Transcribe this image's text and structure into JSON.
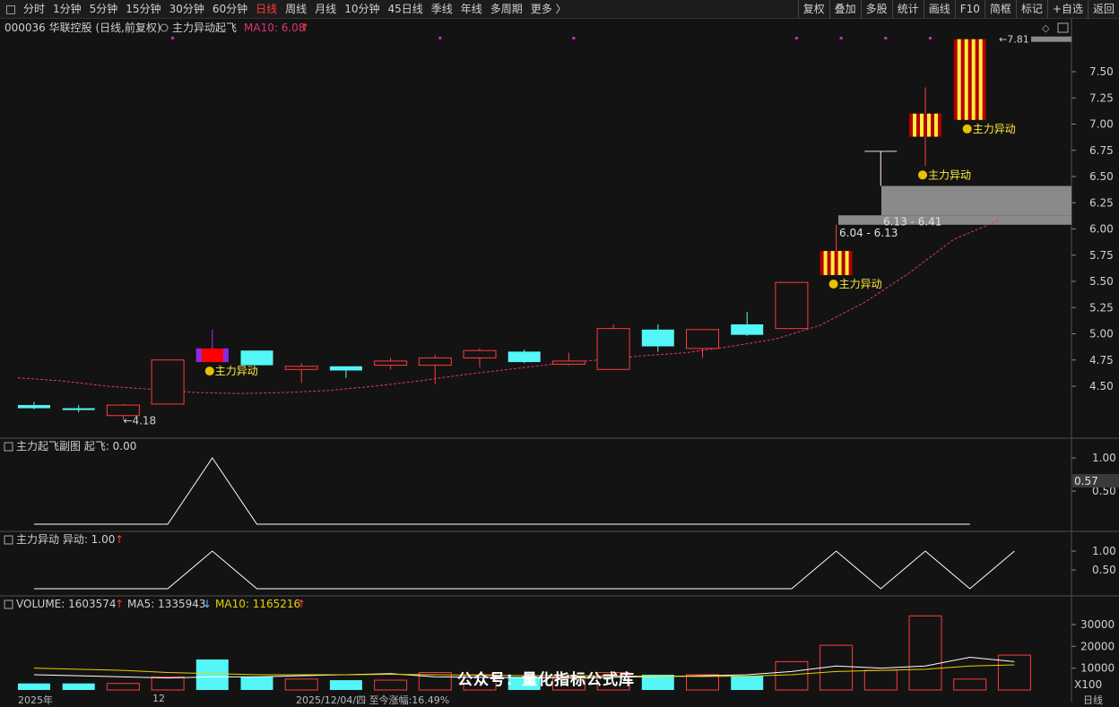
{
  "toolbar": {
    "periods": [
      "分时",
      "1分钟",
      "5分钟",
      "15分钟",
      "30分钟",
      "60分钟",
      "日线",
      "周线",
      "月线",
      "10分钟",
      "45日线",
      "季线",
      "年线",
      "多周期",
      "更多 〉"
    ],
    "active_period": "日线",
    "buttons": [
      "复权",
      "叠加",
      "多股",
      "统计",
      "画线",
      "F10",
      "简框",
      "标记",
      "+自选",
      "返回"
    ]
  },
  "main_header": {
    "stock": "000036 华联控股 (日线,前复权)",
    "indicator": "主力异动起飞",
    "ma10_label": "MA10: 6.08",
    "ma10_arrow": "↑"
  },
  "sub1_header": {
    "name": "主力起飞副图",
    "value_label": "起飞: 0.00"
  },
  "sub2_header": {
    "name": "主力异动",
    "value_label": "异动: 1.00",
    "arrow": "↑"
  },
  "vol_header": {
    "vol_label": "VOLUME: 1603574",
    "vol_arrow": "↑",
    "ma5_label": "MA5: 1335943",
    "ma5_arrow": "↓",
    "ma10_label": "MA10: 1165216",
    "ma10_arrow": "↑"
  },
  "annotations": {
    "signal": "主力异动",
    "low_price": "4.18",
    "high_price": "7.81",
    "zone1": "6.04 - 6.13",
    "zone2": "6.13 - 6.41"
  },
  "axis": {
    "price_ticks": [
      "7.50",
      "7.25",
      "7.00",
      "6.75",
      "6.50",
      "6.25",
      "6.00",
      "5.75",
      "5.50",
      "5.25",
      "5.00",
      "4.75",
      "4.50"
    ],
    "sub_ticks": [
      "1.00",
      "0.50"
    ],
    "sub1_current": "0.57",
    "vol_ticks": [
      "30000",
      "20000",
      "10000"
    ],
    "vol_unit": "X100"
  },
  "footer": {
    "year": "2025年",
    "month": "12",
    "date_info": "2025/12/04/四  至今涨幅:16.49%",
    "right": "日线"
  },
  "watermark": "公众号：量化指标公式库",
  "colors": {
    "up": "#ff3b3b",
    "down": "#54f6f7",
    "ma_main": "#e0307a",
    "signal_text": "#ffeb3b",
    "vol_ma5": "#ffffff",
    "vol_ma10": "#e6d200",
    "zone": "#8a8a8a"
  },
  "chart_data": {
    "type": "candlestick",
    "candles": [
      {
        "o": 4.32,
        "h": 4.35,
        "l": 4.28,
        "c": 4.29
      },
      {
        "o": 4.29,
        "h": 4.32,
        "l": 4.25,
        "c": 4.28
      },
      {
        "o": 4.22,
        "h": 4.33,
        "l": 4.18,
        "c": 4.32
      },
      {
        "o": 4.33,
        "h": 4.75,
        "l": 4.33,
        "c": 4.75
      },
      {
        "o": 4.86,
        "h": 5.04,
        "l": 4.73,
        "c": 4.73,
        "signal": true,
        "special": "mark"
      },
      {
        "o": 4.84,
        "h": 4.84,
        "l": 4.7,
        "c": 4.7
      },
      {
        "o": 4.66,
        "h": 4.72,
        "l": 4.53,
        "c": 4.69
      },
      {
        "o": 4.69,
        "h": 4.69,
        "l": 4.58,
        "c": 4.65
      },
      {
        "o": 4.7,
        "h": 4.77,
        "l": 4.66,
        "c": 4.74
      },
      {
        "o": 4.7,
        "h": 4.8,
        "l": 4.52,
        "c": 4.77
      },
      {
        "o": 4.77,
        "h": 4.86,
        "l": 4.68,
        "c": 4.84
      },
      {
        "o": 4.83,
        "h": 4.85,
        "l": 4.72,
        "c": 4.73
      },
      {
        "o": 4.71,
        "h": 4.82,
        "l": 4.7,
        "c": 4.74
      },
      {
        "o": 4.66,
        "h": 5.09,
        "l": 4.66,
        "c": 5.05
      },
      {
        "o": 5.04,
        "h": 5.09,
        "l": 4.83,
        "c": 4.88
      },
      {
        "o": 4.86,
        "h": 5.04,
        "l": 4.77,
        "c": 5.04
      },
      {
        "o": 5.09,
        "h": 5.21,
        "l": 4.98,
        "c": 4.99
      },
      {
        "o": 5.05,
        "h": 5.49,
        "l": 5.05,
        "c": 5.49
      },
      {
        "o": 5.56,
        "h": 6.04,
        "l": 5.56,
        "c": 5.79,
        "signal": true,
        "special": "striped"
      },
      {
        "o": 6.74,
        "h": 6.74,
        "l": 6.41,
        "c": 6.74,
        "special": "tline"
      },
      {
        "o": 6.88,
        "h": 7.35,
        "l": 6.6,
        "c": 7.1,
        "signal": true,
        "special": "striped"
      },
      {
        "o": 7.04,
        "h": 7.81,
        "l": 7.04,
        "c": 7.81,
        "signal": true,
        "special": "striped"
      }
    ],
    "ma10": [
      4.58,
      4.55,
      4.5,
      4.47,
      4.44,
      4.43,
      4.44,
      4.46,
      4.5,
      4.55,
      4.61,
      4.66,
      4.71,
      4.75,
      4.79,
      4.82,
      4.88,
      4.95,
      5.08,
      5.3,
      5.58,
      5.9,
      6.08
    ],
    "zones": [
      {
        "low": 6.04,
        "high": 6.13
      },
      {
        "low": 6.13,
        "high": 6.41
      }
    ],
    "takeoff": [
      0,
      0,
      0,
      0,
      1,
      0,
      0,
      0,
      0,
      0,
      0,
      0,
      0,
      0,
      0,
      0,
      0,
      0,
      0,
      0,
      0,
      0
    ],
    "anomaly": [
      0,
      0,
      0,
      0,
      1,
      0,
      0,
      0,
      0,
      0,
      0,
      0,
      0,
      0,
      0,
      0,
      0,
      0,
      1,
      0,
      1,
      0,
      1
    ],
    "volume": [
      3000,
      3000,
      3000,
      6000,
      14000,
      6000,
      5000,
      4500,
      4500,
      8000,
      7000,
      6000,
      6000,
      8000,
      7000,
      7000,
      6500,
      13000,
      20500,
      9000,
      34000,
      5000,
      16000
    ],
    "vol_ma5": [
      7000,
      6500,
      6000,
      5500,
      6000,
      6000,
      6500,
      7000,
      7500,
      6000,
      5800,
      5600,
      5500,
      5800,
      6200,
      6500,
      7000,
      8500,
      11000,
      10000,
      11000,
      15000,
      13000
    ],
    "vol_ma10": [
      10000,
      9500,
      9000,
      8000,
      7500,
      7000,
      7000,
      7000,
      7200,
      7000,
      6800,
      6600,
      6500,
      6400,
      6300,
      6200,
      6300,
      7000,
      8500,
      9000,
      9500,
      11000,
      11500
    ],
    "price_range": [
      4.18,
      7.81
    ],
    "bars_mark_top": [
      3,
      9,
      12,
      17,
      18,
      19,
      20
    ]
  }
}
